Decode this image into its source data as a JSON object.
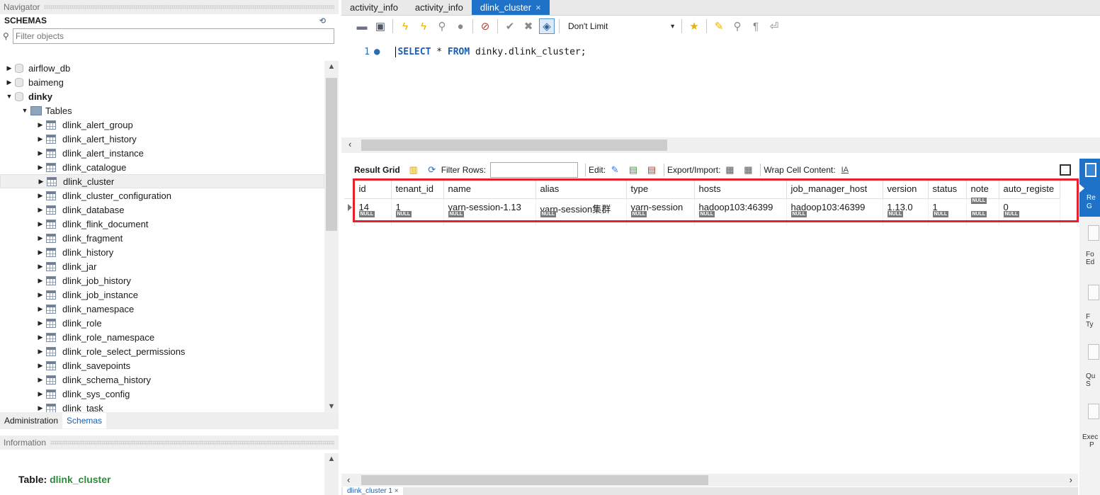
{
  "navigator": {
    "title": "Navigator",
    "schemas_label": "SCHEMAS",
    "filter_placeholder": "Filter objects",
    "tree": [
      {
        "label": "airflow_db",
        "level": 0,
        "type": "schema",
        "expanded": false
      },
      {
        "label": "baimeng",
        "level": 0,
        "type": "schema",
        "expanded": false
      },
      {
        "label": "dinky",
        "level": 0,
        "type": "schema",
        "expanded": true,
        "bold": true
      },
      {
        "label": "Tables",
        "level": 1,
        "type": "folder",
        "expanded": true
      },
      {
        "label": "dlink_alert_group",
        "level": 2,
        "type": "table"
      },
      {
        "label": "dlink_alert_history",
        "level": 2,
        "type": "table"
      },
      {
        "label": "dlink_alert_instance",
        "level": 2,
        "type": "table"
      },
      {
        "label": "dlink_catalogue",
        "level": 2,
        "type": "table"
      },
      {
        "label": "dlink_cluster",
        "level": 2,
        "type": "table",
        "selected": true
      },
      {
        "label": "dlink_cluster_configuration",
        "level": 2,
        "type": "table"
      },
      {
        "label": "dlink_database",
        "level": 2,
        "type": "table"
      },
      {
        "label": "dlink_flink_document",
        "level": 2,
        "type": "table"
      },
      {
        "label": "dlink_fragment",
        "level": 2,
        "type": "table"
      },
      {
        "label": "dlink_history",
        "level": 2,
        "type": "table"
      },
      {
        "label": "dlink_jar",
        "level": 2,
        "type": "table"
      },
      {
        "label": "dlink_job_history",
        "level": 2,
        "type": "table"
      },
      {
        "label": "dlink_job_instance",
        "level": 2,
        "type": "table"
      },
      {
        "label": "dlink_namespace",
        "level": 2,
        "type": "table"
      },
      {
        "label": "dlink_role",
        "level": 2,
        "type": "table"
      },
      {
        "label": "dlink_role_namespace",
        "level": 2,
        "type": "table"
      },
      {
        "label": "dlink_role_select_permissions",
        "level": 2,
        "type": "table"
      },
      {
        "label": "dlink_savepoints",
        "level": 2,
        "type": "table"
      },
      {
        "label": "dlink_schema_history",
        "level": 2,
        "type": "table"
      },
      {
        "label": "dlink_sys_config",
        "level": 2,
        "type": "table"
      },
      {
        "label": "dlink_task",
        "level": 2,
        "type": "table"
      }
    ],
    "tabs": {
      "administration": "Administration",
      "schemas": "Schemas"
    },
    "info_title": "Information",
    "info_table_prefix": "Table: ",
    "info_table_name": "dlink_cluster"
  },
  "editor": {
    "tabs": [
      {
        "label": "activity_info",
        "active": false
      },
      {
        "label": "activity_info",
        "active": false
      },
      {
        "label": "dlink_cluster",
        "active": true,
        "close": "×"
      }
    ],
    "limit_value": "Don't Limit",
    "sql": {
      "line_number": "1",
      "kw1": "SELECT",
      "mid": " * ",
      "kw2": "FROM",
      "rest": " dinky.dlink_cluster;"
    }
  },
  "results": {
    "result_grid_label": "Result Grid",
    "filter_rows_label": "Filter Rows:",
    "edit_label": "Edit:",
    "export_import_label": "Export/Import:",
    "wrap_label": "Wrap Cell Content:",
    "columns": [
      "id",
      "tenant_id",
      "name",
      "alias",
      "type",
      "hosts",
      "job_manager_host",
      "version",
      "status",
      "note",
      "auto_registe"
    ],
    "row": [
      "14",
      "1",
      "yarn-session-1.13",
      "yarn-session集群",
      "yarn-session",
      "hadoop103:46399",
      "hadoop103:46399",
      "1.13.0",
      "1",
      "NULL",
      "0"
    ],
    "null_label": "NULL",
    "bottom_tab": "dlink_cluster 1 ×"
  },
  "sidepanel": {
    "active_label": [
      "Re",
      "G"
    ],
    "items": [
      [
        "Fo",
        "Ed"
      ],
      [
        "F",
        "Ty"
      ],
      [
        "Qu",
        "S"
      ],
      [
        "Exec",
        "P"
      ]
    ]
  }
}
